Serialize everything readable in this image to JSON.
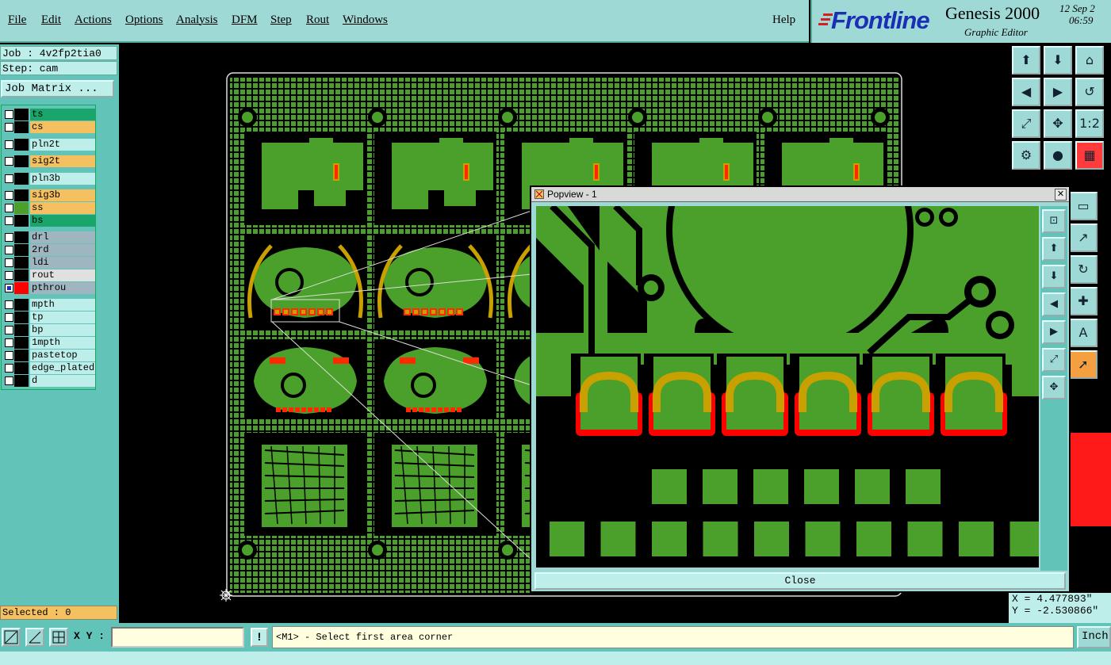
{
  "menubar": {
    "items": [
      "File",
      "Edit",
      "Actions",
      "Options",
      "Analysis",
      "DFM",
      "Step",
      "Rout",
      "Windows"
    ],
    "help": "Help"
  },
  "brand": {
    "logo": "Frontline",
    "product": "Genesis 2000",
    "subtitle": "Graphic Editor",
    "date": "12 Sep 2",
    "time": "06:59"
  },
  "job": {
    "job_line": "Job : 4v2fp2tia0",
    "step_line": "Step: cam",
    "matrix_button": "Job Matrix ..."
  },
  "layers": [
    {
      "name": "ts",
      "color": "#1aa56a",
      "bg": "#1aa56a",
      "swatch": "#000"
    },
    {
      "name": "cs",
      "color": "#f5c060",
      "bg": "#f5c060",
      "swatch": "#000"
    },
    {
      "name": "pln2t",
      "color": "#9fd9d6",
      "bg": "#bdeee9",
      "swatch": "#000"
    },
    {
      "name": "sig2t",
      "color": "#f5c060",
      "bg": "#f5c060",
      "swatch": "#000"
    },
    {
      "name": "pln3b",
      "color": "#9fd9d6",
      "bg": "#bdeee9",
      "swatch": "#000"
    },
    {
      "name": "sig3b",
      "color": "#f5c060",
      "bg": "#f5c060",
      "swatch": "#000"
    },
    {
      "name": "ss",
      "color": "#f5c060",
      "bg": "#f5c060",
      "swatch": "#4aa02a"
    },
    {
      "name": "bs",
      "color": "#1aa56a",
      "bg": "#1aa56a",
      "swatch": "#000"
    },
    {
      "name": "drl",
      "color": "#9fb6c0",
      "bg": "#9fb6c0",
      "swatch": "#000"
    },
    {
      "name": "2rd",
      "color": "#9fb6c0",
      "bg": "#9fb6c0",
      "swatch": "#000"
    },
    {
      "name": "ldi",
      "color": "#9fb6c0",
      "bg": "#9fb6c0",
      "swatch": "#000"
    },
    {
      "name": "rout",
      "color": "#d9d9d9",
      "bg": "#e0e0e0",
      "swatch": "#000"
    },
    {
      "name": "pthrou",
      "color": "#9fb6c0",
      "bg": "#9fb6c0",
      "swatch": "#ff0000"
    },
    {
      "name": "mpth",
      "color": "#bdeee9",
      "bg": "#bdeee9",
      "swatch": "#000"
    },
    {
      "name": "tp",
      "color": "#bdeee9",
      "bg": "#bdeee9",
      "swatch": "#000"
    },
    {
      "name": "bp",
      "color": "#bdeee9",
      "bg": "#bdeee9",
      "swatch": "#000"
    },
    {
      "name": "1mpth",
      "color": "#bdeee9",
      "bg": "#bdeee9",
      "swatch": "#000"
    },
    {
      "name": "pastetop",
      "color": "#bdeee9",
      "bg": "#bdeee9",
      "swatch": "#000"
    },
    {
      "name": "edge_plated",
      "color": "#bdeee9",
      "bg": "#bdeee9",
      "swatch": "#000"
    },
    {
      "name": "d",
      "color": "#bdeee9",
      "bg": "#bdeee9",
      "swatch": "#000"
    }
  ],
  "selected": "Selected : 0",
  "popview": {
    "title": "Popview - 1",
    "close_label": "Close"
  },
  "coords": {
    "x": "X = 4.477893\"",
    "y": "Y = -2.530866\""
  },
  "statusbar": {
    "xy_label": "X Y :",
    "xy_value": "",
    "prompt": "<M1> - Select first area corner",
    "units": "Inch"
  },
  "colors": {
    "copper": "#4aa02a",
    "pad_outline": "#ff0000",
    "gold": "#c8a000",
    "panel": "#9fd9d6"
  },
  "icons": {
    "toolbox": [
      "zoom-home-icon",
      "zoom-prev-icon",
      "home-icon",
      "pan-left-icon",
      "pan-right-icon",
      "undo-icon",
      "fit-icon",
      "zoom-in-icon",
      "one-to-one-icon",
      "snap-icon",
      "measure-icon",
      "layers-icon",
      "ruler-icon",
      "point-icon",
      "rotate-icon",
      "cross-icon",
      "text-icon",
      "select-icon"
    ],
    "popview": [
      "zoom-icon",
      "up-icon",
      "down-icon",
      "left-icon",
      "right-icon",
      "fit-icon",
      "center-icon"
    ]
  }
}
